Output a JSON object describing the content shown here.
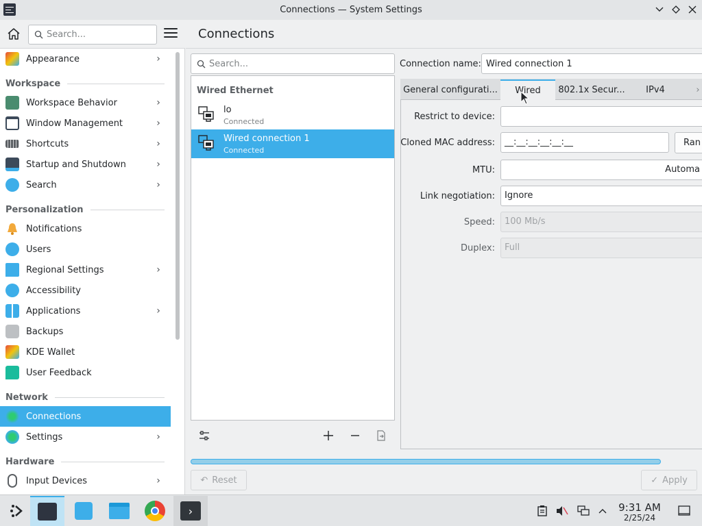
{
  "window": {
    "title": "Connections — System Settings"
  },
  "sidebar": {
    "search_placeholder": "Search...",
    "items": [
      {
        "label": "Appearance",
        "has_children": true
      },
      {
        "header": "Workspace"
      },
      {
        "label": "Workspace Behavior",
        "has_children": true
      },
      {
        "label": "Window Management",
        "has_children": true
      },
      {
        "label": "Shortcuts",
        "has_children": true
      },
      {
        "label": "Startup and Shutdown",
        "has_children": true
      },
      {
        "label": "Search",
        "has_children": true
      },
      {
        "header": "Personalization"
      },
      {
        "label": "Notifications",
        "has_children": false
      },
      {
        "label": "Users",
        "has_children": false
      },
      {
        "label": "Regional Settings",
        "has_children": true
      },
      {
        "label": "Accessibility",
        "has_children": false
      },
      {
        "label": "Applications",
        "has_children": true
      },
      {
        "label": "Backups",
        "has_children": false
      },
      {
        "label": "KDE Wallet",
        "has_children": false
      },
      {
        "label": "User Feedback",
        "has_children": false
      },
      {
        "header": "Network"
      },
      {
        "label": "Connections",
        "has_children": false,
        "selected": true
      },
      {
        "label": "Settings",
        "has_children": true
      },
      {
        "header": "Hardware"
      },
      {
        "label": "Input Devices",
        "has_children": true
      }
    ]
  },
  "page": {
    "title": "Connections"
  },
  "connections": {
    "search_placeholder": "Search...",
    "group": "Wired Ethernet",
    "items": [
      {
        "name": "lo",
        "status": "Connected",
        "selected": false
      },
      {
        "name": "Wired connection 1",
        "status": "Connected",
        "selected": true
      }
    ]
  },
  "details": {
    "connection_name_label": "Connection name:",
    "connection_name_value": "Wired connection 1",
    "tabs": [
      "General configurati...",
      "Wired",
      "802.1x Secur...",
      "IPv4"
    ],
    "active_tab": "Wired",
    "fields": {
      "restrict_label": "Restrict to device:",
      "restrict_value": "",
      "cloned_mac_label": "Cloned MAC address:",
      "cloned_mac_value": "__:__:__:__:__:__",
      "random_button": "Ran",
      "mtu_label": "MTU:",
      "mtu_value": "Automa",
      "link_neg_label": "Link negotiation:",
      "link_neg_value": "Ignore",
      "speed_label": "Speed:",
      "speed_value": "100 Mb/s",
      "duplex_label": "Duplex:",
      "duplex_value": "Full"
    }
  },
  "footer": {
    "reset_label": "Reset",
    "apply_label": "Apply",
    "progress_fraction": 1.0
  },
  "taskbar": {
    "time": "9:31 AM",
    "date": "2/25/24"
  },
  "colors": {
    "accent": "#3daee9",
    "window_bg": "#eff0f1",
    "text": "#232629"
  }
}
